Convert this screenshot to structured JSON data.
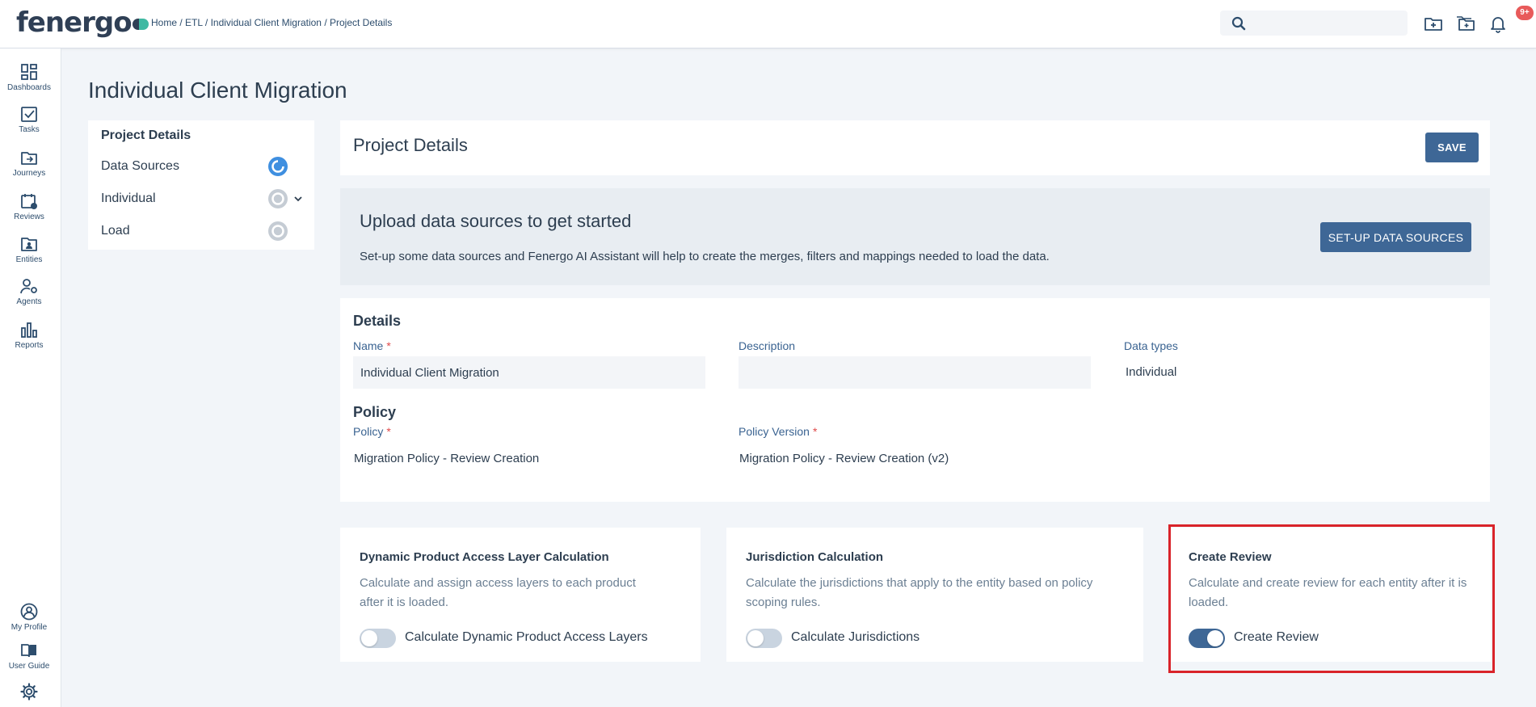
{
  "brand": {
    "logo_text": "fenergo"
  },
  "header": {
    "breadcrumb": "Home / ETL / Individual Client Migration / Project Details",
    "search": {
      "value": "",
      "placeholder": ""
    },
    "notifications_badge": "9+"
  },
  "sidebar": {
    "items": [
      {
        "label": "Dashboards",
        "icon": "dashboard-icon"
      },
      {
        "label": "Tasks",
        "icon": "tasks-icon"
      },
      {
        "label": "Journeys",
        "icon": "journeys-icon"
      },
      {
        "label": "Reviews",
        "icon": "reviews-icon"
      },
      {
        "label": "Entities",
        "icon": "entities-icon"
      },
      {
        "label": "Agents",
        "icon": "agents-icon"
      },
      {
        "label": "Reports",
        "icon": "reports-icon"
      }
    ],
    "bottom_items": [
      {
        "label": "My Profile",
        "icon": "profile-icon"
      },
      {
        "label": "User Guide",
        "icon": "book-icon"
      },
      {
        "label": "",
        "icon": "gear-icon"
      }
    ]
  },
  "page": {
    "title": "Individual Client Migration"
  },
  "steps": {
    "header": "Project Details",
    "items": [
      {
        "label": "Data Sources",
        "status": "active"
      },
      {
        "label": "Individual",
        "status": "pending",
        "expandable": true
      },
      {
        "label": "Load",
        "status": "pending"
      }
    ]
  },
  "project_details": {
    "title": "Project Details",
    "save_label": "SAVE"
  },
  "upload": {
    "title": "Upload data sources to get started",
    "text": "Set-up some data sources and Fenergo AI Assistant will help to create the merges, filters and mappings needed to load the data.",
    "button_label": "SET-UP DATA SOURCES"
  },
  "details": {
    "section_title": "Details",
    "name_label": "Name",
    "name_value": "Individual Client Migration",
    "description_label": "Description",
    "description_value": "",
    "data_types_label": "Data types",
    "data_types_value": "Individual",
    "required_mark": "*"
  },
  "policy": {
    "section_title": "Policy",
    "policy_label": "Policy",
    "policy_value": "Migration Policy - Review Creation",
    "version_label": "Policy Version",
    "version_value": "Migration Policy - Review Creation (v2)"
  },
  "features": [
    {
      "title": "Dynamic Product Access Layer Calculation",
      "description": "Calculate and assign access layers to each product after it is loaded.",
      "toggle_label": "Calculate Dynamic Product Access Layers",
      "enabled": false
    },
    {
      "title": "Jurisdiction Calculation",
      "description": "Calculate the jurisdictions that apply to the entity based on policy scoping rules.",
      "toggle_label": "Calculate Jurisdictions",
      "enabled": false
    },
    {
      "title": "Create Review",
      "description": "Calculate and create review for each entity after it is loaded.",
      "toggle_label": "Create Review",
      "enabled": true
    }
  ],
  "colors": {
    "primary": "#3e6796",
    "highlight": "#d9232a",
    "badge": "#e85a5a",
    "step_active": "#3f8fe0"
  }
}
